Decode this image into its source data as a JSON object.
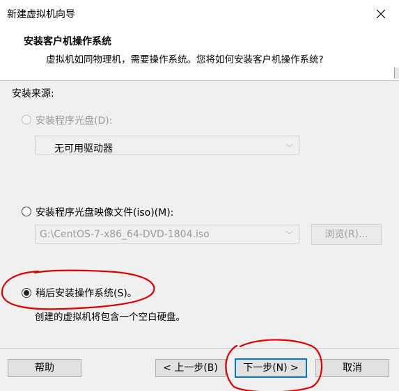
{
  "window": {
    "title": "新建虚拟机向导"
  },
  "header": {
    "title": "安装客户机操作系统",
    "subtitle": "虚拟机如同物理机，需要操作系统。您将如何安装客户机操作系统?"
  },
  "install_source": {
    "label": "安装来源:",
    "options": [
      {
        "label": "安装程序光盘(D):",
        "selected": false,
        "enabled": false
      },
      {
        "label": "安装程序光盘映像文件(iso)(M):",
        "selected": false,
        "enabled": true
      },
      {
        "label": "稍后安装操作系统(S)。",
        "selected": true,
        "enabled": true
      }
    ],
    "drive_select": {
      "value": "无可用驱动器"
    },
    "iso_path": {
      "value": "G:\\CentOS-7-x86_64-DVD-1804.iso"
    },
    "browse_label": "浏览(R)...",
    "later_desc": "创建的虚拟机将包含一个空白硬盘。"
  },
  "footer": {
    "help": "帮助",
    "back": "< 上一步(B)",
    "next": "下一步(N) >",
    "cancel": "取消"
  },
  "annotation_color": "#e00000"
}
